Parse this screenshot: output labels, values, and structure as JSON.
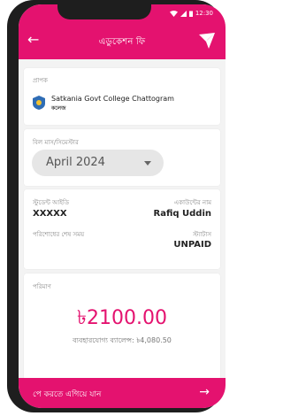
{
  "status_bar": {
    "time": "12:30"
  },
  "app_bar": {
    "title": "এডুকেশন ফি"
  },
  "institution": {
    "label": "প্রাপক",
    "name": "Satkania Govt College Chattogram",
    "type": "কলেজ"
  },
  "bill_month": {
    "label": "বিল মাস/সিমেস্টার",
    "selected": "April 2024"
  },
  "details": {
    "student_id_label": "স্টুডেন্ট আইডি",
    "student_id": "XXXXX",
    "account_name_label": "একাউন্টের নাম",
    "account_name": "Rafiq Uddin",
    "due_label": "পরিশোধের শেষ সময়",
    "status_label": "স্ট্যাটাস",
    "status": "UNPAID"
  },
  "amount": {
    "label": "পরিমাণ",
    "value": "৳2100.00",
    "balance": "ব্যবহারযোগ্য ব্যালেন্স: ৳4,080.50"
  },
  "footer": {
    "proceed_label": "পে করতে এগিয়ে যান"
  },
  "colors": {
    "accent": "#e4126f",
    "background": "#f3f3f3"
  }
}
